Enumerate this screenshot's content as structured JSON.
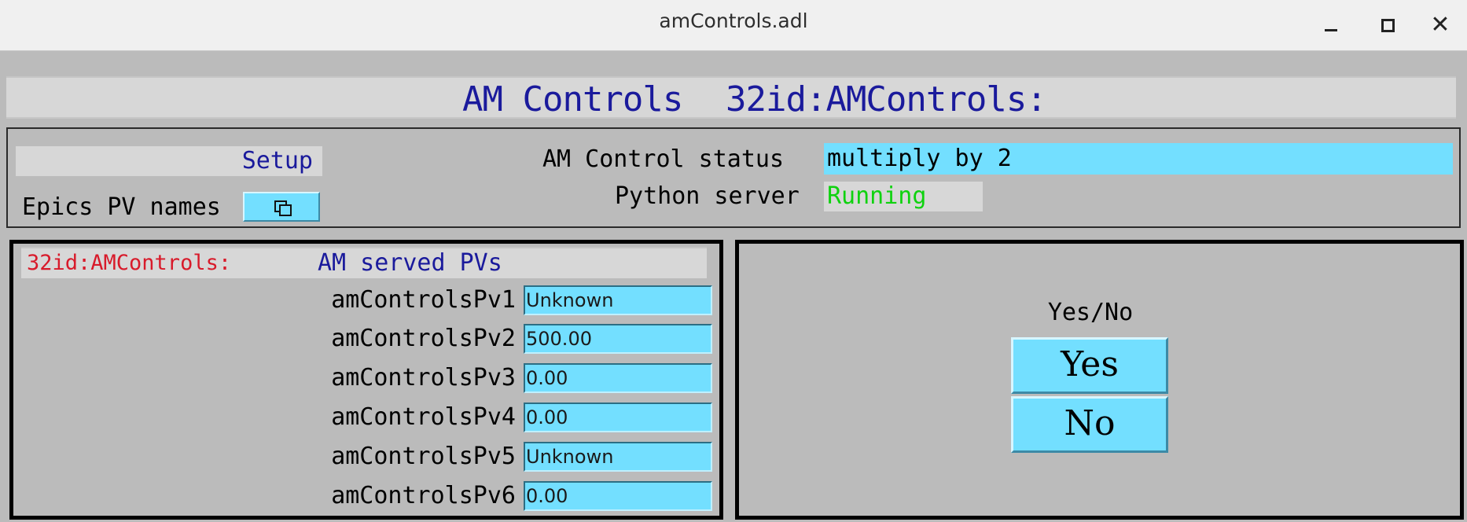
{
  "window": {
    "title": "amControls.adl"
  },
  "banner": {
    "title": "AM Controls",
    "prefix": "32id:AMControls:"
  },
  "top": {
    "setup_label": "Setup",
    "epics_label": "Epics PV names",
    "status_label": "AM Control status",
    "status_value": "multiply by 2",
    "python_label": "Python server",
    "python_value": "Running"
  },
  "pv_panel": {
    "prefix": "32id:AMControls:",
    "header": "AM served PVs",
    "rows": [
      {
        "label": "amControlsPv1",
        "value": "Unknown"
      },
      {
        "label": "amControlsPv2",
        "value": "500.00"
      },
      {
        "label": "amControlsPv3",
        "value": "0.00"
      },
      {
        "label": "amControlsPv4",
        "value": "0.00"
      },
      {
        "label": "amControlsPv5",
        "value": "Unknown"
      },
      {
        "label": "amControlsPv6",
        "value": "0.00"
      }
    ]
  },
  "yesno": {
    "label": "Yes/No",
    "yes": "Yes",
    "no": "No"
  },
  "colors": {
    "background": "#bbbbbb",
    "field": "#73dfff",
    "title_blue": "#1a1a9c",
    "prefix_red": "#d81a2a",
    "running_green": "#0fd20f"
  },
  "icons": {
    "related_display": "related-display-icon"
  }
}
